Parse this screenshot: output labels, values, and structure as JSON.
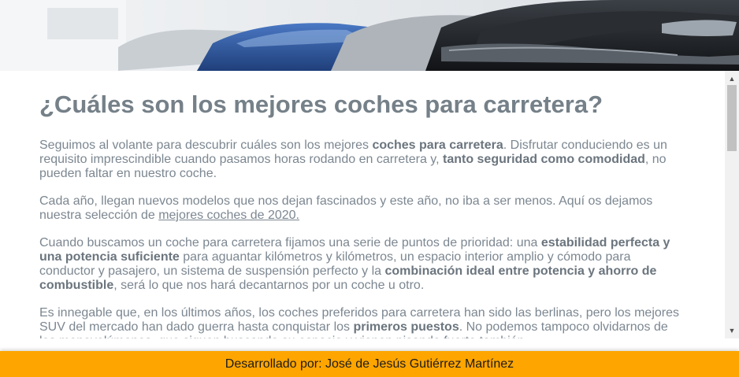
{
  "hero": {
    "image": "cars-in-showroom-banner"
  },
  "article": {
    "title": "¿Cuáles son los mejores coches para carretera?",
    "p1": {
      "t1": "Seguimos al volante para descubrir cuáles son los mejores ",
      "b1": "coches para carretera",
      "t2": ". Disfrutar conduciendo es un requisito imprescindible cuando pasamos horas rodando en carretera y, ",
      "b2": "tanto seguridad como comodidad",
      "t3": ", no pueden faltar en nuestro coche."
    },
    "p2": {
      "t1": "Cada año, llegan nuevos modelos que nos dejan fascinados y este año, no iba a ser menos. Aquí os dejamos nuestra selección de ",
      "link": "mejores coches de 2020."
    },
    "p3": {
      "t1": "Cuando buscamos un coche para carretera fijamos una serie de puntos de prioridad: una ",
      "b1": "estabilidad perfecta y una potencia suficiente",
      "t2": " para aguantar kilómetros y kilómetros, un espacio interior amplio y cómodo para conductor y pasajero, un sistema de suspensión perfecto y la ",
      "b2": "combinación ideal entre potencia y ahorro de combustible",
      "t3": ", será lo que nos hará decantarnos por un coche u otro."
    },
    "p4": {
      "t1": "Es innegable que, en los últimos años, los coches preferidos para carretera han sido las berlinas, pero los mejores SUV del mercado han dado guerra hasta conquistar los ",
      "b1": "primeros puestos",
      "t2": ". No podemos tampoco olvidarnos de los monovolúmenes, que siguen buscando su espacio y vienen pisando fuerte también."
    }
  },
  "scrollbar": {
    "up_glyph": "▲",
    "down_glyph": "▼"
  },
  "footer": {
    "text": "Desarrollado por: José de Jesús Gutiérrez Martínez"
  }
}
